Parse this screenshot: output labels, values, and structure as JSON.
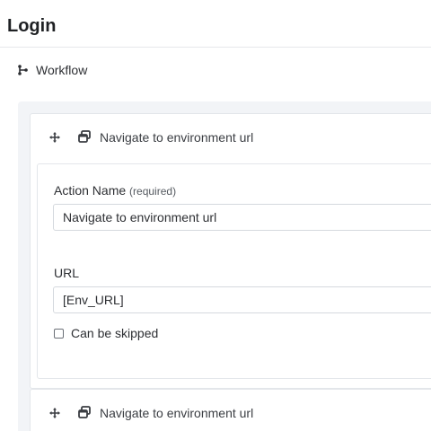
{
  "page": {
    "title": "Login"
  },
  "workflow": {
    "label": "Workflow"
  },
  "steps": [
    {
      "title": "Navigate to environment url",
      "fields": {
        "action_name_label": "Action Name",
        "action_name_required": "(required)",
        "action_name_value": "Navigate to environment url",
        "url_label": "URL",
        "url_value": "[Env_URL]",
        "skip_label": "Can be skipped",
        "skip_checked": false
      }
    },
    {
      "title": "Navigate to environment url"
    }
  ],
  "icons": {
    "workflow": "workflow-branch-icon",
    "drag": "move-arrows-icon",
    "action": "navigate-window-icon",
    "checkbox": "checkbox-unchecked"
  }
}
